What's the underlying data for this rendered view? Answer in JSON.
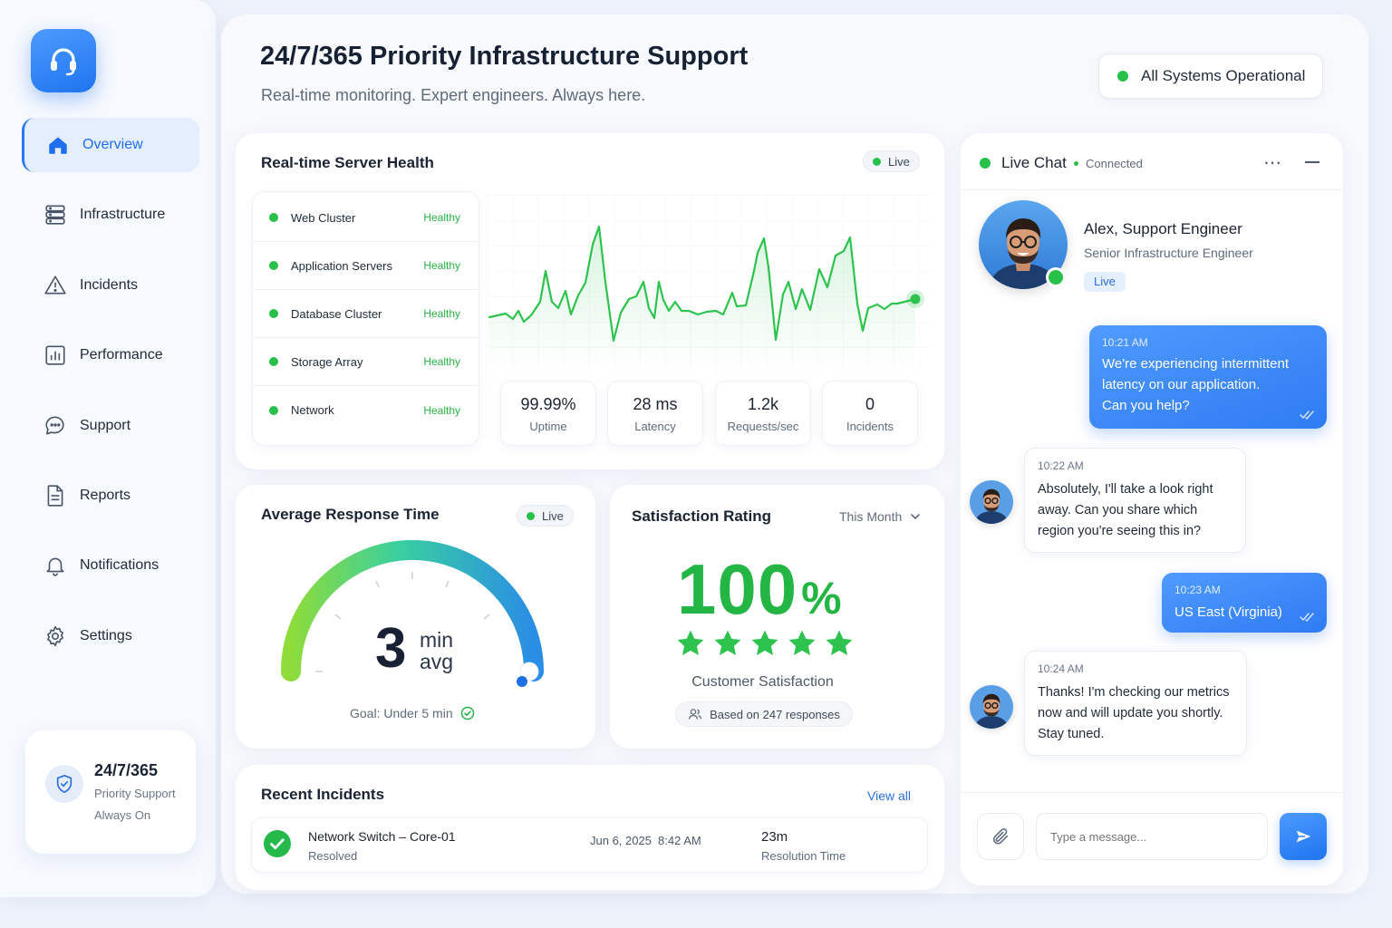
{
  "sidebar": {
    "items": [
      {
        "label": "Overview",
        "icon": "home-icon",
        "active": true
      },
      {
        "label": "Infrastructure",
        "icon": "server-icon"
      },
      {
        "label": "Incidents",
        "icon": "warning-icon"
      },
      {
        "label": "Performance",
        "icon": "bar-chart-icon"
      },
      {
        "label": "Support",
        "icon": "chat-icon"
      },
      {
        "label": "Reports",
        "icon": "document-icon"
      },
      {
        "label": "Notifications",
        "icon": "bell-icon"
      },
      {
        "label": "Settings",
        "icon": "gear-icon"
      }
    ],
    "promo": {
      "title": "24/7/365",
      "line1": "Priority Support",
      "line2": "Always On"
    }
  },
  "header": {
    "title": "24/7/365 Priority Infrastructure Support",
    "subtitle": "Real-time monitoring. Expert engineers. Always here.",
    "status": "All Systems Operational"
  },
  "server_health": {
    "title": "Real-time Server Health",
    "live": "Live",
    "rows": [
      {
        "name": "Web Cluster",
        "status": "Healthy"
      },
      {
        "name": "Application Servers",
        "status": "Healthy"
      },
      {
        "name": "Database Cluster",
        "status": "Healthy"
      },
      {
        "name": "Storage Array",
        "status": "Healthy"
      },
      {
        "name": "Network",
        "status": "Healthy"
      }
    ],
    "stats": [
      {
        "value": "99.99%",
        "label": "Uptime"
      },
      {
        "value": "28 ms",
        "label": "Latency"
      },
      {
        "value": "1.2k",
        "label": "Requests/sec"
      },
      {
        "value": "0",
        "label": "Incidents"
      }
    ]
  },
  "response_time": {
    "title": "Average Response Time",
    "live": "Live",
    "value": "3",
    "unit1": "min",
    "unit2": "avg",
    "goal": "Goal: Under 5 min",
    "gauge_fraction": 1.0
  },
  "satisfaction": {
    "title": "Satisfaction Rating",
    "period": "This Month",
    "value": "100",
    "percent_sign": "%",
    "stars": 5,
    "label": "Customer Satisfaction",
    "based_on": "Based on 247 responses"
  },
  "incidents": {
    "title": "Recent Incidents",
    "view_all": "View all",
    "rows": [
      {
        "name": "Network Switch – Core-01",
        "status": "Resolved",
        "date": "Jun 6, 2025",
        "time": "8:42 AM",
        "duration": "23m",
        "duration_label": "Resolution Time"
      }
    ]
  },
  "chat": {
    "title": "Live Chat",
    "connection": "Connected",
    "agent": {
      "name": "Alex, Support Engineer",
      "role": "Senior Infrastructure Engineer",
      "badge": "Live"
    },
    "messages": [
      {
        "from": "user",
        "time": "10:21 AM",
        "lines": [
          "We're experiencing intermittent",
          "latency on our application.",
          "Can you help?"
        ]
      },
      {
        "from": "agent",
        "time": "10:22 AM",
        "lines": [
          "Absolutely, I'll take a look right",
          "away. Can you share which",
          "region you're seeing this in?"
        ]
      },
      {
        "from": "user",
        "time": "10:23 AM",
        "lines": [
          "US East (Virginia)"
        ]
      },
      {
        "from": "agent",
        "time": "10:24 AM",
        "lines": [
          "Thanks! I'm checking our metrics",
          "now and will update you shortly.",
          "Stay tuned."
        ]
      }
    ],
    "input_placeholder": "Type a message..."
  },
  "colors": {
    "accent": "#2a78f2",
    "healthy": "#27c14a",
    "star": "#2ec34f"
  }
}
